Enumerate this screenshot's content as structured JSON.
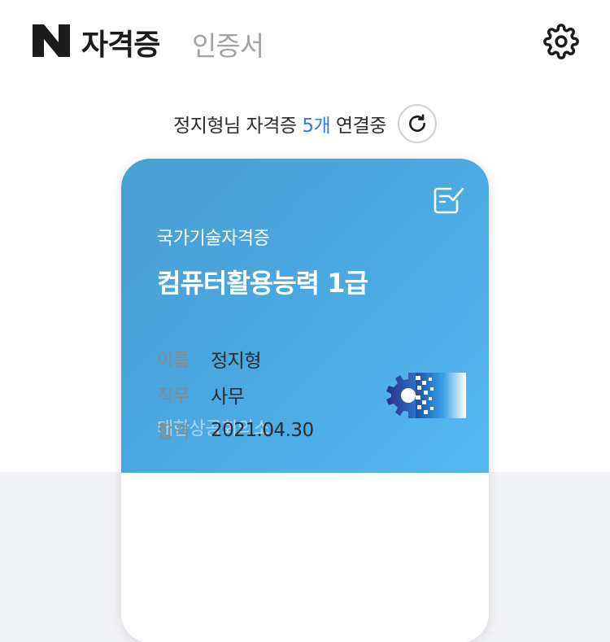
{
  "header": {
    "logo_letter": "N",
    "title": "자격증",
    "subtitle": "인증서",
    "settings_icon": "gear-icon"
  },
  "status": {
    "prefix": "정지형님 자격증 ",
    "count": "5개",
    "suffix": " 연결중",
    "refresh_icon": "refresh-icon",
    "count_color": "#2f7de1"
  },
  "card": {
    "category": "국가기술자격증",
    "title": "컴퓨터활용능력 1급",
    "issuer": "대한상공회의소",
    "check_icon": "checklist-icon",
    "gradient_start": "#4a9fd4",
    "gradient_end": "#56b7f2",
    "details": [
      {
        "label": "이름",
        "value": "정지형"
      },
      {
        "label": "직무",
        "value": "사무"
      },
      {
        "label": "합격",
        "value": "2021.04.30"
      }
    ]
  }
}
